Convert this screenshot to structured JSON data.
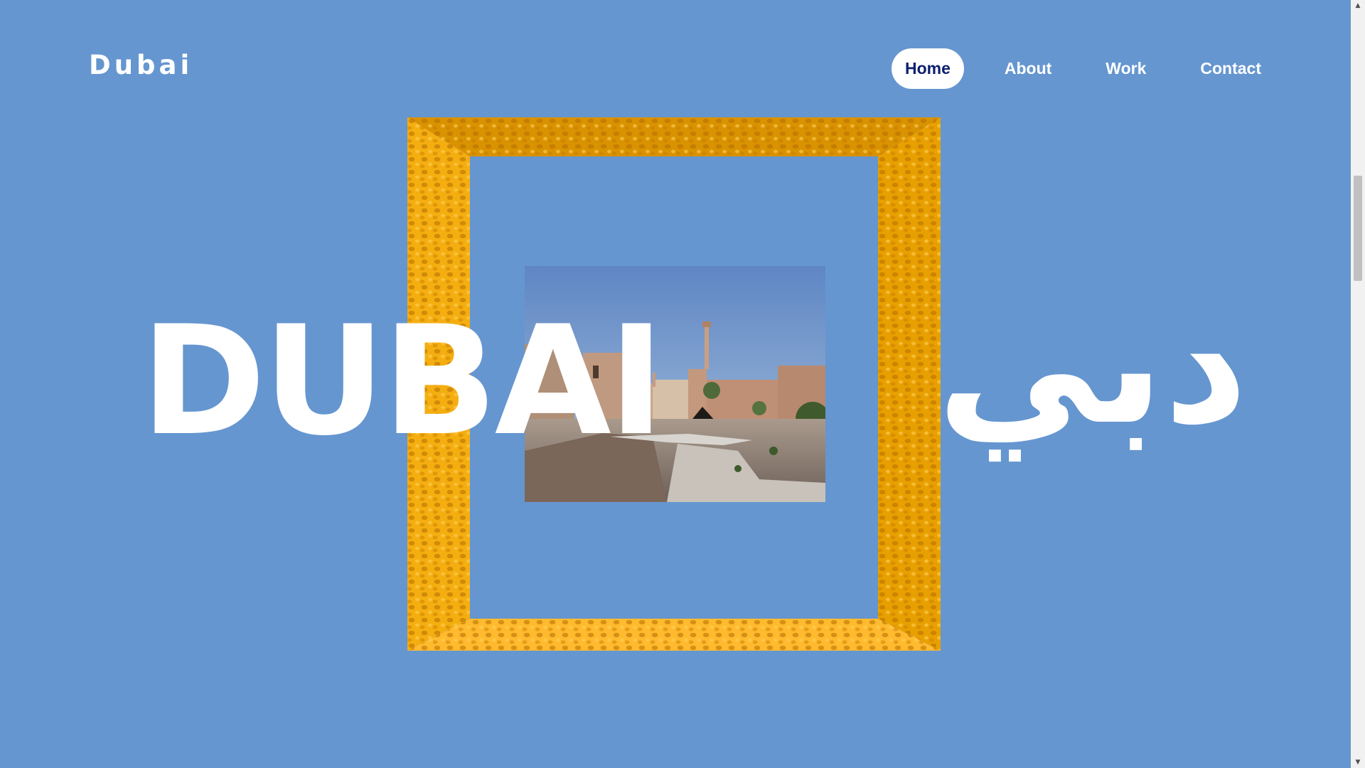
{
  "header": {
    "logo": "Dubai",
    "nav": [
      {
        "label": "Home",
        "active": true
      },
      {
        "label": "About",
        "active": false
      },
      {
        "label": "Work",
        "active": false
      },
      {
        "label": "Contact",
        "active": false
      }
    ]
  },
  "hero": {
    "title": "DUBAI",
    "title_arabic": "دبي",
    "image_alt": "Al Fahidi historical district with wind tower and minaret"
  },
  "colors": {
    "background": "#6596d0",
    "frame_gold": "#f2a900",
    "nav_active_text": "#0b1f6e"
  },
  "scrollbar": {
    "up_icon": "▲",
    "down_icon": "▼"
  }
}
